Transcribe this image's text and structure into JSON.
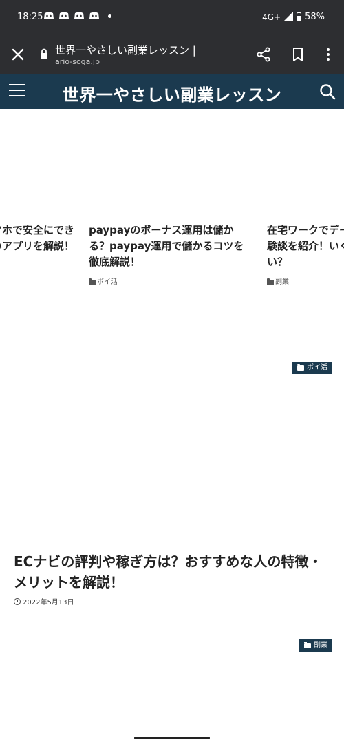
{
  "status": {
    "time": "18:25",
    "network": "4G+",
    "battery": "58%",
    "notification_icons": [
      "discord-icon",
      "discord-icon",
      "discord-icon",
      "discord-icon"
    ]
  },
  "browser": {
    "page_title": "世界一やさしい副業レッスン |",
    "url": "ario-soga.jp"
  },
  "site": {
    "title": "世界一やさしい副業レッスン"
  },
  "carousel": [
    {
      "title": "マホで安全にでき\nいアプリを解説！",
      "category": ""
    },
    {
      "title": "paypayのボーナス運用は儲かる？paypay運用で儲かるコツを徹底解説！",
      "category": "ポイ活"
    },
    {
      "title": "在宅ワークでデー\n験談を紹介！いく\nい？",
      "category": "副業"
    }
  ],
  "articles": [
    {
      "badge": "ポイ活",
      "title": "ECナビの評判や稼ぎ方は？おすすめな人の特徴・メリットを解説！",
      "date": "2022年5月13日"
    },
    {
      "badge": "副業"
    }
  ]
}
